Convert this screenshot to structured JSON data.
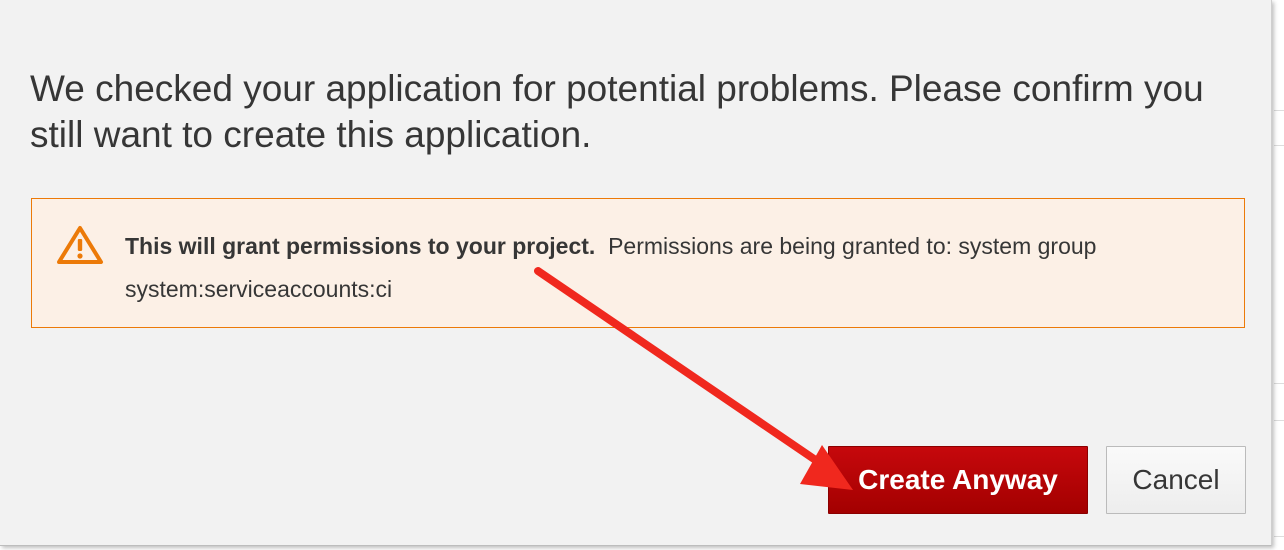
{
  "dialog": {
    "message": "We checked your application for potential problems. Please confirm you still want to create this application.",
    "alert": {
      "title": "This will grant permissions to your project.",
      "body": "Permissions are being granted to: system group system:serviceaccounts:ci",
      "icon": "warning-triangle-icon",
      "color": "#ec7a08",
      "background": "#fcf0e6"
    },
    "buttons": {
      "create_label": "Create Anyway",
      "cancel_label": "Cancel"
    },
    "colors": {
      "primary": "#b80000",
      "annotation_arrow": "#f0281e"
    }
  }
}
